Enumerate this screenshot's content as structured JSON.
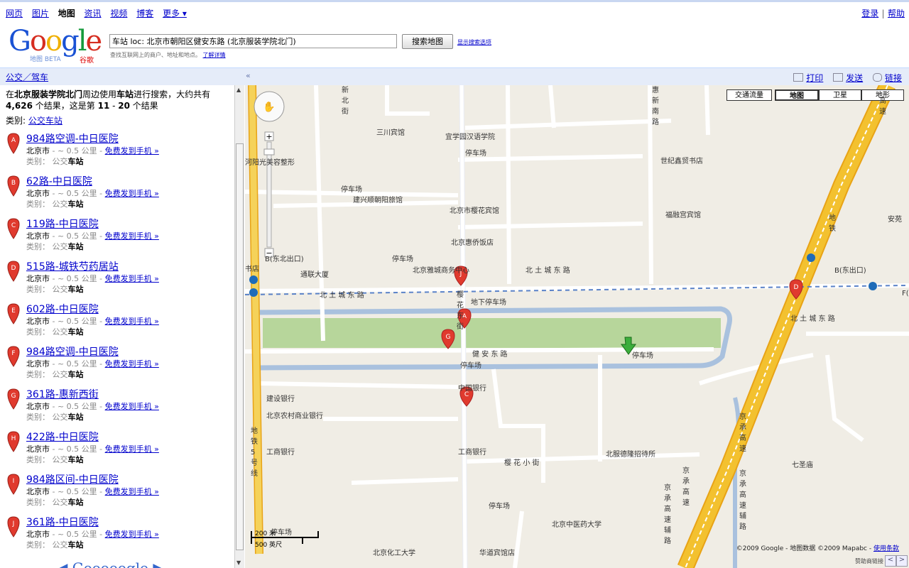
{
  "topnav": {
    "links": [
      "网页",
      "图片",
      "地图",
      "资讯",
      "视频",
      "博客",
      "更多 ▾"
    ],
    "active": "地图",
    "login": "登录",
    "help": "帮助"
  },
  "logo": {
    "word": "Google",
    "sub": "地图 BETA",
    "cn": "谷歌"
  },
  "search": {
    "value": "车站 loc: 北京市朝阳区健安东路 (北京服装学院北门)",
    "button": "搜索地图",
    "options": "显示搜索选项",
    "hint": "查找互联网上的商户、地址和地点。",
    "hint_link": "了解详情"
  },
  "bar": {
    "transit": "公交／驾车",
    "collapse": "«",
    "print": "打印",
    "send": "发送",
    "link": "链接"
  },
  "summary": {
    "p1": "在",
    "place": "北京服装学院北门",
    "p2": "周边使用",
    "term": "车站",
    "p3": "进行搜索，大约共有",
    "total": "4,626",
    "p4": " 个结果，这是第 ",
    "from": "11",
    "dash": " - ",
    "to": "20",
    "p5": " 个结果"
  },
  "category": {
    "label": "类别: ",
    "link": "公交车站"
  },
  "results": [
    {
      "letter": "A",
      "title": "984路空调-中日医院",
      "city": "北京市",
      "dist": " - ~ 0.5 公里 - ",
      "sms": "免费发到手机 »",
      "cat_label": "类别：",
      "cat1": "公交",
      "cat2": "车站"
    },
    {
      "letter": "B",
      "title": "62路-中日医院",
      "city": "北京市",
      "dist": " - ~ 0.5 公里 - ",
      "sms": "免费发到手机 »",
      "cat_label": "类别：",
      "cat1": "公交",
      "cat2": "车站"
    },
    {
      "letter": "C",
      "title": "119路-中日医院",
      "city": "北京市",
      "dist": " - ~ 0.5 公里 - ",
      "sms": "免费发到手机 »",
      "cat_label": "类别：",
      "cat1": "公交",
      "cat2": "车站"
    },
    {
      "letter": "D",
      "title": "515路-城铁芍药居站",
      "city": "北京市",
      "dist": " - ~ 0.5 公里 - ",
      "sms": "免费发到手机 »",
      "cat_label": "类别：",
      "cat1": "公交",
      "cat2": "车站"
    },
    {
      "letter": "E",
      "title": "602路-中日医院",
      "city": "北京市",
      "dist": " - ~ 0.5 公里 - ",
      "sms": "免费发到手机 »",
      "cat_label": "类别：",
      "cat1": "公交",
      "cat2": "车站"
    },
    {
      "letter": "F",
      "title": "984路空调-中日医院",
      "city": "北京市",
      "dist": " - ~ 0.5 公里 - ",
      "sms": "免费发到手机 »",
      "cat_label": "类别：",
      "cat1": "公交",
      "cat2": "车站"
    },
    {
      "letter": "G",
      "title": "361路-惠新西街",
      "city": "北京市",
      "dist": " - ~ 0.5 公里 - ",
      "sms": "免费发到手机 »",
      "cat_label": "类别：",
      "cat1": "公交",
      "cat2": "车站"
    },
    {
      "letter": "H",
      "title": "422路-中日医院",
      "city": "北京市",
      "dist": " - ~ 0.5 公里 - ",
      "sms": "免费发到手机 »",
      "cat_label": "类别：",
      "cat1": "公交",
      "cat2": "车站"
    },
    {
      "letter": "I",
      "title": "984路区间-中日医院",
      "city": "北京市",
      "dist": " - ~ 0.5 公里 - ",
      "sms": "免费发到手机 »",
      "cat_label": "类别：",
      "cat1": "公交",
      "cat2": "车站"
    },
    {
      "letter": "J",
      "title": "361路-中日医院",
      "city": "北京市",
      "dist": " - ~ 0.5 公里 - ",
      "sms": "免费发到手机 »",
      "cat_label": "类别：",
      "cat1": "公交",
      "cat2": "车站"
    }
  ],
  "gnav": "◀ Gooooogle ▶",
  "map": {
    "types": [
      "交通流量",
      "地图",
      "卫星",
      "地形"
    ],
    "selected": "地图",
    "scale": [
      "200 米",
      "500 英尺"
    ],
    "copyright": "©2009 Google - 地图数据 ©2009 Mapabc - ",
    "terms": "使用条款",
    "sponsor": "赞助商链接",
    "labels": {
      "sanchuan": "三川宾馆",
      "yixue": "宜学园汉语学院",
      "park1": "停车场",
      "shiji": "世纪鑫贸书店",
      "hehe": "河阳光美容整形",
      "park2": "停车场",
      "jianxing": "建兴顺朝阳旅馆",
      "yinghua_hotel": "北京市樱花宾馆",
      "fuyuan": "福融宫宾馆",
      "huiqiao": "北京惠侨饭店",
      "park3": "停车场",
      "yayuan": "北京雅城商务中心",
      "tonglian": "通联大厦",
      "exit_b": "B(东北出口)",
      "exit_b2": "B(东出口)",
      "beitucheng_w": "北 土 城 东 路",
      "beitucheng_n": "北 土 城 东 路",
      "beitucheng_e": "北 土 城 东 路",
      "under_park": "地下停车场",
      "jianan": "健 安 东 路",
      "park4": "停车场",
      "park5": "停车场",
      "bank_const": "建设银行",
      "bank_china": "中国银行",
      "bank_rural": "北京农村商业银行",
      "bank_icbc1": "工商银行",
      "bank_icbc2": "工商银行",
      "yinghua_st": "樱 花 小 街",
      "guest": "北服德隆招待所",
      "qisheng": "七圣庙",
      "park6": "停车场",
      "tcm": "北京中医药大学",
      "park7": "停车场",
      "chem": "北京化工大学",
      "hotel_s": "华道宾馆店",
      "xinbei": "新北街",
      "huinan": "惠新南路",
      "yinghua_e": "樱花东街",
      "metro5": "地铁5号线",
      "metro13": "地铁",
      "jingcheng1": "京承高速",
      "jingcheng2": "京承高速辅路",
      "jingcheng3": "京承高速辅路",
      "jingcheng4": "京承高速",
      "bookstore": "书店",
      "expressway": "高速",
      "anhui": "安苑",
      "f_out": "F(",
      "jingcheng5": "京承高速"
    }
  },
  "colors": {
    "link": "#0000cc",
    "bar": "#e5ecf9",
    "map_bg": "#f0ede5",
    "highway": "#f3c12f",
    "green": "#b7d69b",
    "water": "#a9c1de",
    "pin": "#e03a2e",
    "pin_green": "#3cae3c"
  }
}
